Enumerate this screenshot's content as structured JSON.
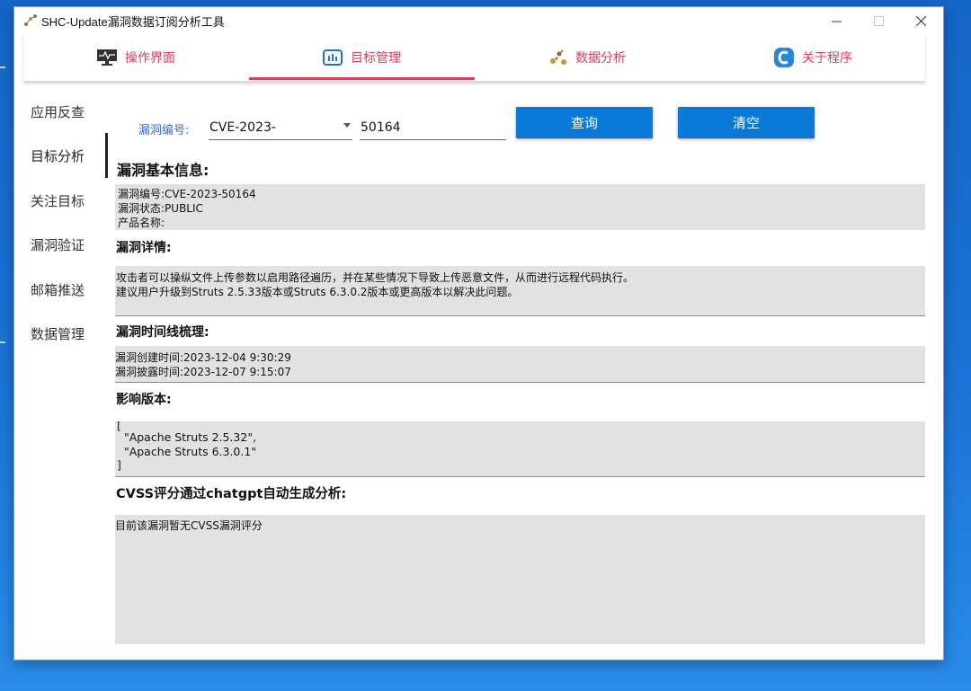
{
  "window": {
    "title": "SHC-Update漏洞数据订阅分析工具"
  },
  "tabs": [
    {
      "label": "操作界面",
      "icon": "monitor-icon"
    },
    {
      "label": "目标管理",
      "icon": "dashboard-icon",
      "active": true
    },
    {
      "label": "数据分析",
      "icon": "molecule-icon"
    },
    {
      "label": "关于程序",
      "icon": "app-logo-icon"
    }
  ],
  "sidebar": {
    "items": [
      {
        "label": "应用反查"
      },
      {
        "label": "目标分析",
        "selected": true
      },
      {
        "label": "关注目标"
      },
      {
        "label": "漏洞验证"
      },
      {
        "label": "邮箱推送"
      },
      {
        "label": "数据管理"
      }
    ]
  },
  "search": {
    "label": "漏洞编号:",
    "prefix_value": "CVE-2023-",
    "id_value": "50164",
    "query_button": "查询",
    "clear_button": "清空"
  },
  "sections": {
    "basic_title": "漏洞基本信息:",
    "basic_lines": [
      "漏洞编号:CVE-2023-50164",
      "漏洞状态:PUBLIC",
      "产品名称:"
    ],
    "detail_title": "漏洞详情:",
    "detail_lines": [
      "攻击者可以操纵文件上传参数以启用路径遍历，并在某些情况下导致上传恶意文件，从而进行远程代码执行。",
      "建议用户升级到Struts 2.5.33版本或Struts 6.3.0.2版本或更高版本以解决此问题。"
    ],
    "timeline_title": "漏洞时间线梳理:",
    "timeline_lines": [
      "漏洞创建时间:2023-12-04 9:30:29",
      "漏洞披露时间:2023-12-07 9:15:07"
    ],
    "versions_title": "影响版本:",
    "versions_lines": [
      "[",
      "  \"Apache Struts 2.5.32\",",
      "  \"Apache Struts 6.3.0.1\"",
      "]"
    ],
    "cvss_title": "CVSS评分通过chatgpt自动生成分析:",
    "cvss_lines": [
      "目前该漏洞暂无CVSS漏洞评分"
    ]
  },
  "colors": {
    "accent": "#e23b5a",
    "button": "#0a7ad8",
    "label_blue": "#3a6ad8",
    "panel": "#e2e2e2"
  }
}
